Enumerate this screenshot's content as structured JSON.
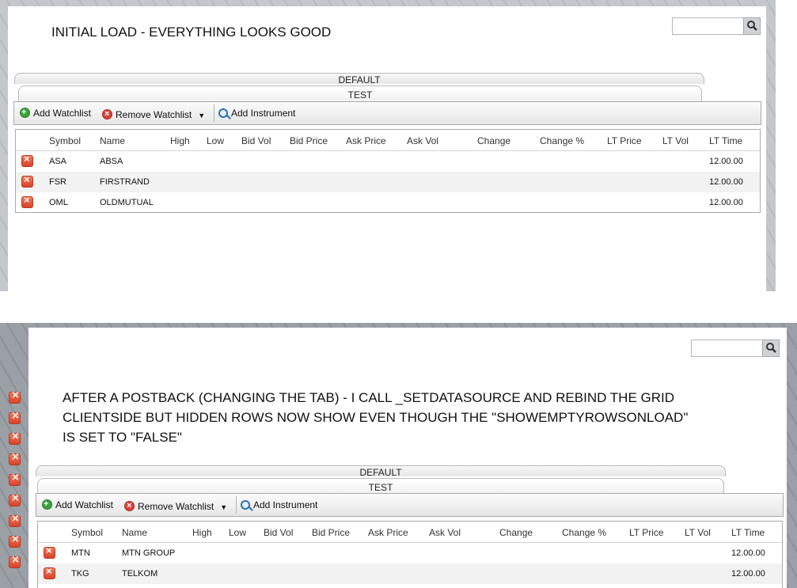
{
  "top": {
    "annotation": "INITIAL LOAD - EVERYTHING LOOKS GOOD",
    "tabs": [
      "DEFAULT",
      "TEST"
    ],
    "toolbar": {
      "add_watchlist": "Add Watchlist",
      "remove_watchlist": "Remove Watchlist",
      "add_instrument": "Add Instrument"
    },
    "columns": [
      "Symbol",
      "Name",
      "High",
      "Low",
      "Bid Vol",
      "Bid Price",
      "Ask Price",
      "Ask Vol",
      "Change",
      "Change %",
      "LT Price",
      "LT Vol",
      "LT Time"
    ],
    "rows": [
      {
        "symbol": "ASA",
        "name": "ABSA",
        "lt_time": "12.00.00"
      },
      {
        "symbol": "FSR",
        "name": "FIRSTRAND",
        "lt_time": "12.00.00"
      },
      {
        "symbol": "OML",
        "name": "OLDMUTUAL",
        "lt_time": "12.00.00"
      }
    ]
  },
  "bottom": {
    "annotation_lines": [
      "AFTER A POSTBACK (CHANGING THE TAB) - I CALL _SETDATASOURCE AND REBIND THE GRID",
      "CLIENTSIDE BUT HIDDEN ROWS NOW SHOW EVEN THOUGH THE \"SHOWEMPTYROWSONLOAD\"",
      "IS SET TO \"FALSE\""
    ],
    "tabs": [
      "DEFAULT",
      "TEST"
    ],
    "toolbar": {
      "add_watchlist": "Add Watchlist",
      "remove_watchlist": "Remove Watchlist",
      "add_instrument": "Add Instrument"
    },
    "columns": [
      "Symbol",
      "Name",
      "High",
      "Low",
      "Bid Vol",
      "Bid Price",
      "Ask Price",
      "Ask Vol",
      "Change",
      "Change %",
      "LT Price",
      "LT Vol",
      "LT Time"
    ],
    "rows": [
      {
        "symbol": "MTN",
        "name": "MTN GROUP",
        "lt_time": "12.00.00"
      },
      {
        "symbol": "TKG",
        "name": "TELKOM",
        "lt_time": "12.00.00"
      }
    ],
    "stray_row_buttons": 9
  },
  "icons": {
    "search": "search-icon",
    "add": "add-circle-icon",
    "remove": "remove-circle-icon",
    "instrument": "magnifier-icon",
    "delete_row": "delete-row-icon"
  }
}
